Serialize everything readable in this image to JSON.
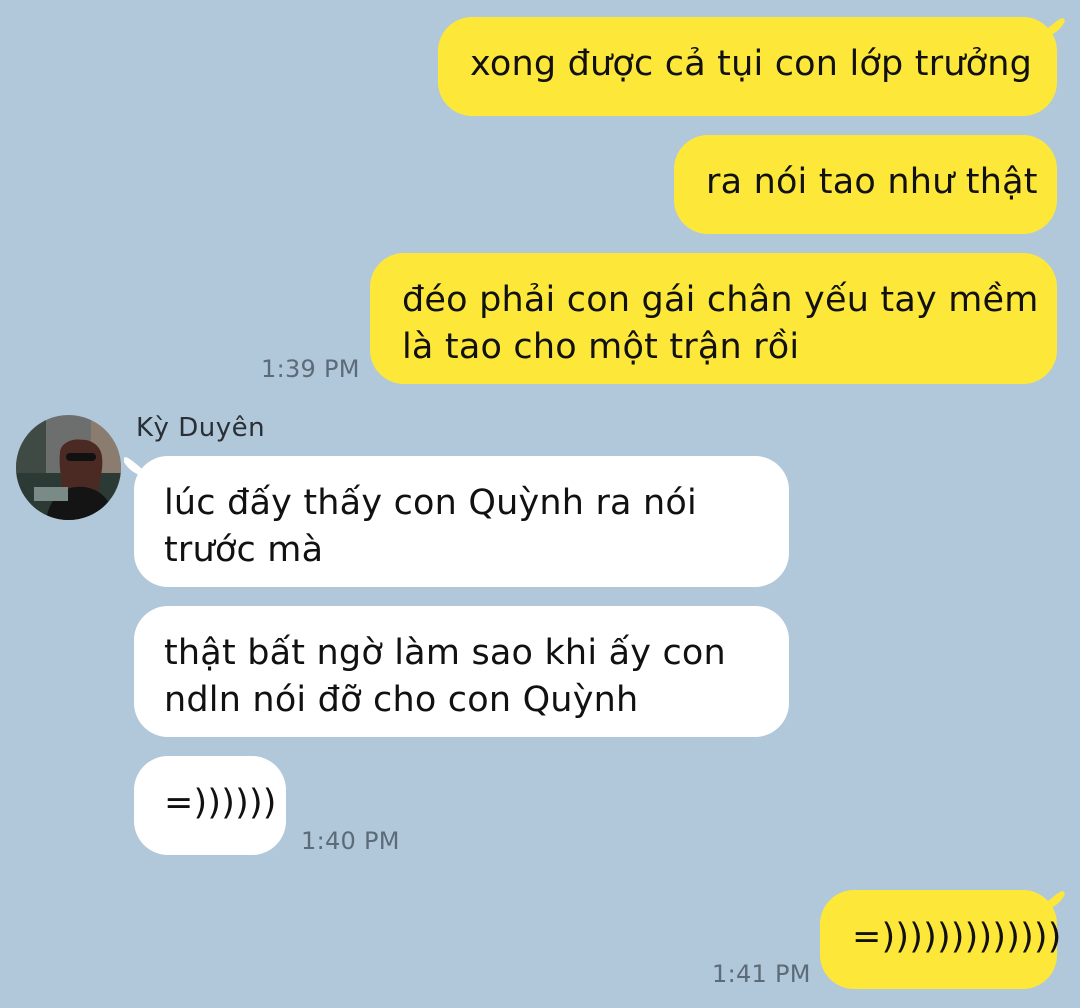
{
  "messages_out_1": {
    "lines": [
      "xong được cả tụi con lớp trưởng"
    ]
  },
  "messages_out_2": {
    "lines": [
      "ra nói tao như thật"
    ]
  },
  "messages_out_3": {
    "lines": [
      "đéo phải con gái chân yếu tay mềm",
      "là tao cho một trận rồi"
    ],
    "time": "1:39 PM"
  },
  "contact": {
    "name": "Kỳ Duyên"
  },
  "messages_in_1": {
    "lines": [
      "lúc đấy thấy con Quỳnh ra nói",
      "trước mà"
    ]
  },
  "messages_in_2": {
    "lines": [
      "thật bất ngờ làm sao khi ấy con",
      "ndln nói đỡ cho con Quỳnh"
    ]
  },
  "messages_in_3": {
    "lines": [
      "=))))))"
    ],
    "time": "1:40 PM"
  },
  "messages_out_4": {
    "lines": [
      "=)))))))))))))"
    ],
    "time": "1:41 PM"
  },
  "colors": {
    "background": "#b1c7da",
    "outgoing_bubble": "#fde83a",
    "incoming_bubble": "#ffffff",
    "timestamp": "#5c6b78"
  },
  "icons": {
    "avatar": "contact-avatar-photo"
  }
}
